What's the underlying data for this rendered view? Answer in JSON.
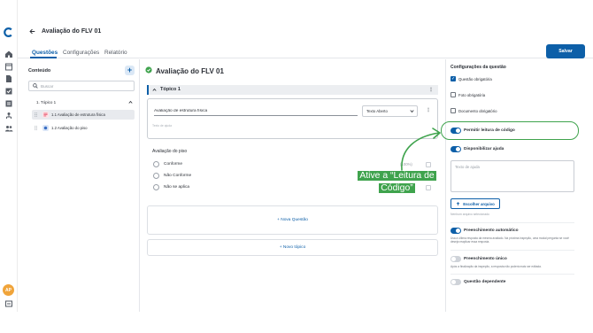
{
  "header": {
    "title": "Avaliação do FLV 01",
    "save_label": "Salvar"
  },
  "tabs": [
    {
      "label": "Questões",
      "active": true
    },
    {
      "label": "Configurações"
    },
    {
      "label": "Relatório"
    }
  ],
  "content": {
    "title": "Conteúdo",
    "search_placeholder": "Buscar",
    "topic_label": "1. Tópico 1",
    "items": [
      {
        "label": "1.1 Avaliação de estrutura física",
        "icon": "checklist-icon",
        "color": "#e8556d"
      },
      {
        "label": "1.2 Avaliação do piso",
        "icon": "radio-list-icon",
        "color": "#3b6fc4"
      }
    ]
  },
  "main": {
    "title": "Avaliação do FLV 01",
    "topic_label": "Tópico 1",
    "question_text": "Avaliação de estrutura física",
    "question_type": "Texto Aberto",
    "help_placeholder": "Texto de ajuda",
    "piso_label": "Avaliação do piso",
    "options": [
      "Conforme",
      "Não Conforme",
      "Não se aplica"
    ],
    "option_percent": "(100%)",
    "new_question_label": "+ Nova Questão",
    "new_topic_label": "+ Novo tópico"
  },
  "settings": {
    "title": "Configurações da questão",
    "checkboxes": [
      {
        "label": "Questão obrigatória",
        "checked": true
      },
      {
        "label": "Foto obrigatória",
        "checked": false
      },
      {
        "label": "Documento obrigatório",
        "checked": false
      }
    ],
    "read_code_label": "Permitir leitura de código",
    "help_toggle_label": "Disponibilizar ajuda",
    "help_textarea_placeholder": "Texto de ajuda",
    "choose_file_label": "Escolher arquivo",
    "no_file_text": "Nenhum arquivo selecionado",
    "autofill_label": "Preenchimento automático",
    "autofill_desc": "Usa a última resposta da mesma avaliado. Na próxima inspeção, uma modal pergunta se você deseja reaplicar essa resposta.",
    "unique_label": "Preenchimento único",
    "unique_desc": "Após a finalização da inspeção, a resposta não poderá mais ser editada.",
    "dependent_label": "Questão dependente"
  },
  "user": {
    "initials": "AP",
    "color": "#f0a43a"
  },
  "tutorial": {
    "callout_text": "Ative a “Leitura de Código”",
    "color": "#3fa34d"
  },
  "accent_color": "#0d5fa8"
}
